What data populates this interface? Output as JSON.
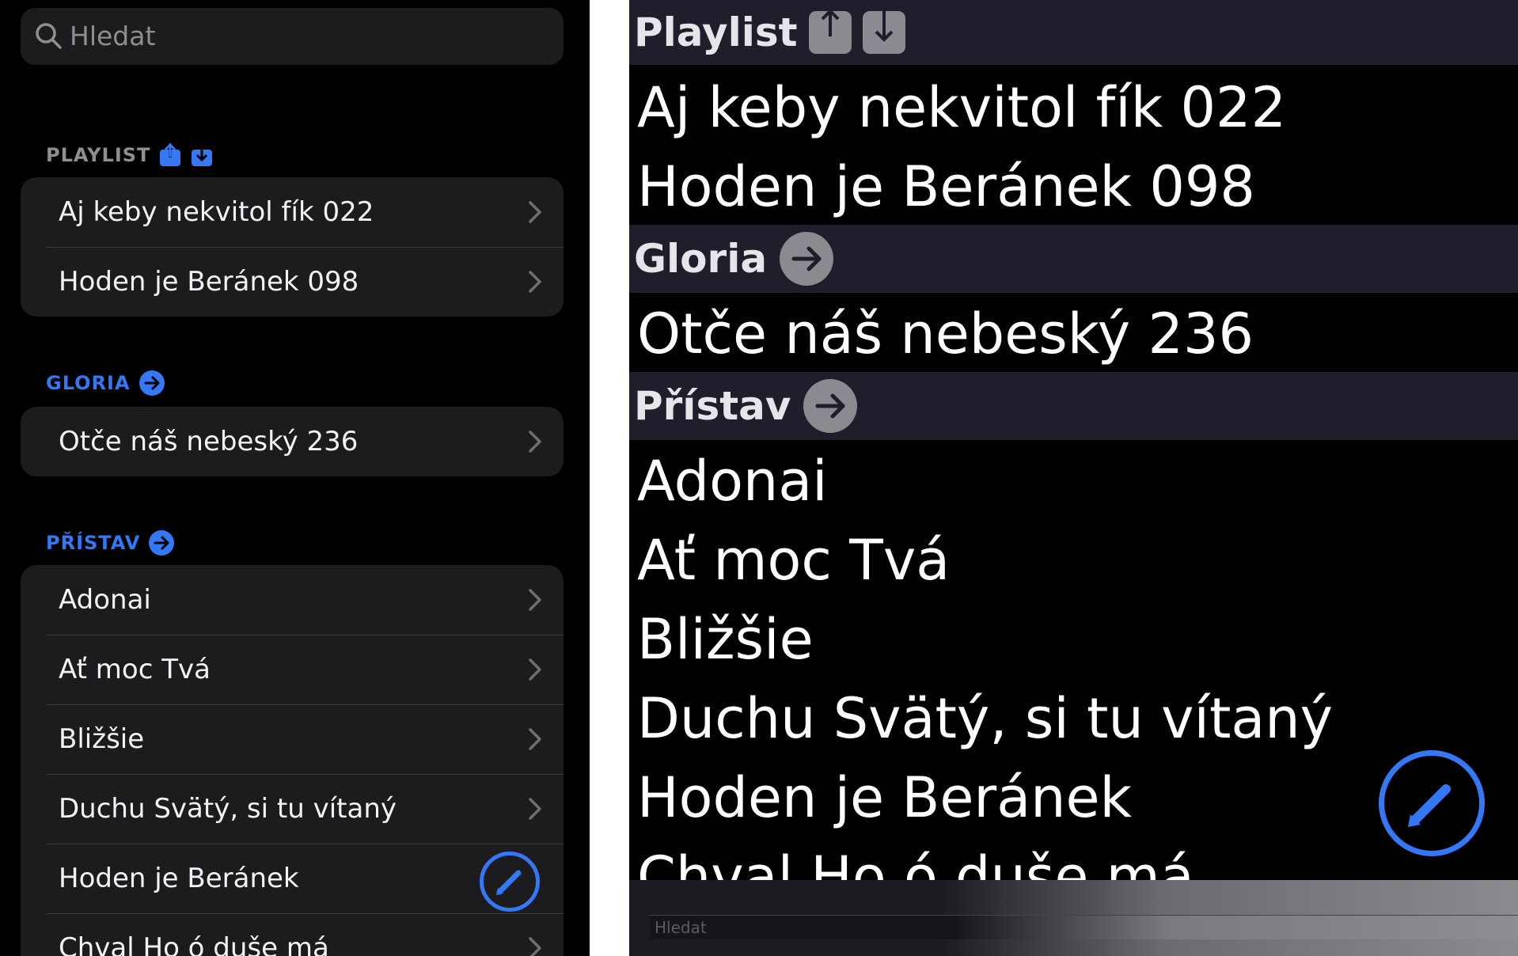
{
  "left": {
    "search": {
      "placeholder": "Hledat",
      "icon": "search-icon"
    },
    "sections": [
      {
        "title": "PLAYLIST",
        "icons": [
          "share-up-icon",
          "download-icon"
        ],
        "color": "#8e8e93",
        "items": [
          "Aj keby nekvitol fík 022",
          "Hoden je Beránek 098"
        ]
      },
      {
        "title": "GLORIA",
        "icons": [
          "arrow-right-circle-icon"
        ],
        "color": "#3478f6",
        "items": [
          "Otče náš nebeský 236"
        ]
      },
      {
        "title": "PŘÍSTAV",
        "icons": [
          "arrow-right-circle-icon"
        ],
        "color": "#3478f6",
        "items": [
          "Adonai",
          "Ať moc Tvá",
          "Bližšie",
          "Duchu Svätý, si tu vítaný",
          "Hoden je Beránek",
          "Chval Ho ó duše má"
        ]
      }
    ],
    "fab_icon": "pencil-icon"
  },
  "right": {
    "sections": [
      {
        "title": "Playlist",
        "items": [
          "Aj keby nekvitol fík 022",
          "Hoden je Beránek 098"
        ]
      },
      {
        "title": "Gloria",
        "items": [
          "Otče náš nebeský 236"
        ]
      },
      {
        "title": "Přístav",
        "items": [
          "Adonai",
          "Ať moc Tvá",
          "Bližšie",
          "Duchu Svätý, si tu vítaný",
          "Hoden je Beránek",
          "Chval Ho ó duše má"
        ]
      }
    ],
    "search": {
      "placeholder": "Hledat"
    },
    "fab_icon": "pencil-icon"
  },
  "colors": {
    "accent": "#3478f6",
    "background": "#000000",
    "cell": "#1c1c1e",
    "header_right": "#1f1e2a"
  }
}
